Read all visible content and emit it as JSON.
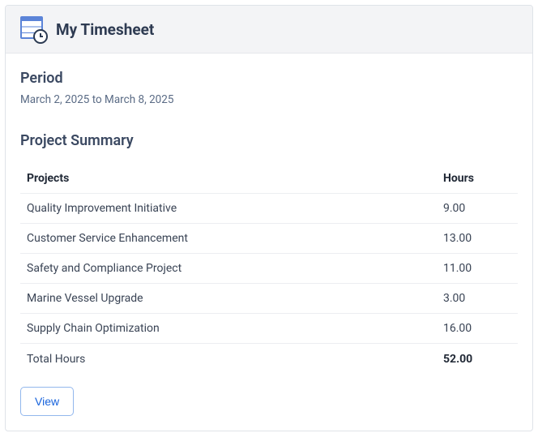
{
  "header": {
    "title": "My Timesheet"
  },
  "period": {
    "label": "Period",
    "value": "March 2, 2025 to March 8, 2025"
  },
  "summary": {
    "title": "Project Summary",
    "columns": {
      "projects": "Projects",
      "hours": "Hours"
    },
    "rows": [
      {
        "name": "Quality Improvement Initiative",
        "hours": "9.00"
      },
      {
        "name": "Customer Service Enhancement",
        "hours": "13.00"
      },
      {
        "name": "Safety and Compliance Project",
        "hours": "11.00"
      },
      {
        "name": "Marine Vessel Upgrade",
        "hours": "3.00"
      },
      {
        "name": "Supply Chain Optimization",
        "hours": "16.00"
      }
    ],
    "total": {
      "label": "Total Hours",
      "value": "52.00"
    }
  },
  "actions": {
    "view": "View"
  }
}
